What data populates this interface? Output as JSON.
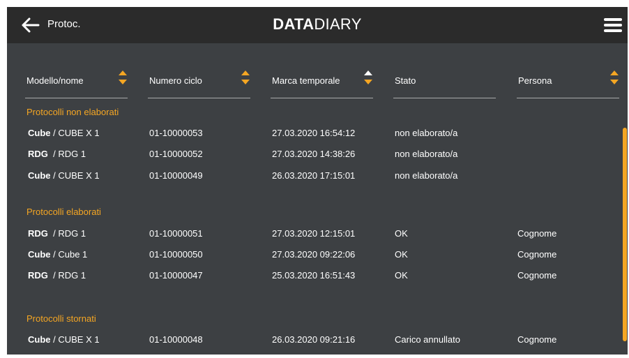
{
  "header": {
    "back_label": "Protoc.",
    "brand_bold": "DATA",
    "brand_light": "DIARY"
  },
  "columns": [
    {
      "label": "Modello/nome"
    },
    {
      "label": "Numero ciclo"
    },
    {
      "label": "Marca temporale"
    },
    {
      "label": "Stato"
    },
    {
      "label": "Persona"
    }
  ],
  "sections": {
    "non_elaborati": {
      "title": "Protocolli non elaborati",
      "rows": [
        {
          "model": "Cube",
          "name": "CUBE X 1",
          "cycle": "01-10000053",
          "timestamp": "27.03.2020 16:54:12",
          "status": "non elaborato/a",
          "person": ""
        },
        {
          "model": "RDG",
          "name": "RDG 1",
          "cycle": "01-10000052",
          "timestamp": "27.03.2020 14:38:26",
          "status": "non elaborato/a",
          "person": ""
        },
        {
          "model": "Cube",
          "name": "CUBE X 1",
          "cycle": "01-10000049",
          "timestamp": "26.03.2020 17:15:01",
          "status": "non elaborato/a",
          "person": ""
        }
      ]
    },
    "elaborati": {
      "title": "Protocolli elaborati",
      "rows": [
        {
          "model": "RDG",
          "name": "RDG 1",
          "cycle": "01-10000051",
          "timestamp": "27.03.2020 12:15:01",
          "status": "OK",
          "person": "Cognome"
        },
        {
          "model": "Cube",
          "name": "Cube 1",
          "cycle": "01-10000050",
          "timestamp": "27.03.2020 09:22:06",
          "status": "OK",
          "person": "Cognome"
        },
        {
          "model": "RDG",
          "name": "RDG 1",
          "cycle": "01-10000047",
          "timestamp": "25.03.2020 16:51:43",
          "status": "OK",
          "person": "Cognome"
        }
      ]
    },
    "stornati": {
      "title": "Protocolli stornati",
      "rows": [
        {
          "model": "Cube",
          "name": "CUBE X 1",
          "cycle": "01-10000048",
          "timestamp": "26.03.2020 09:21:16",
          "status": "Carico annullato",
          "person": "Cognome"
        }
      ]
    }
  },
  "colors": {
    "accent": "#f5a623",
    "background": "#3d4043",
    "topbar": "#2b2b2b"
  }
}
